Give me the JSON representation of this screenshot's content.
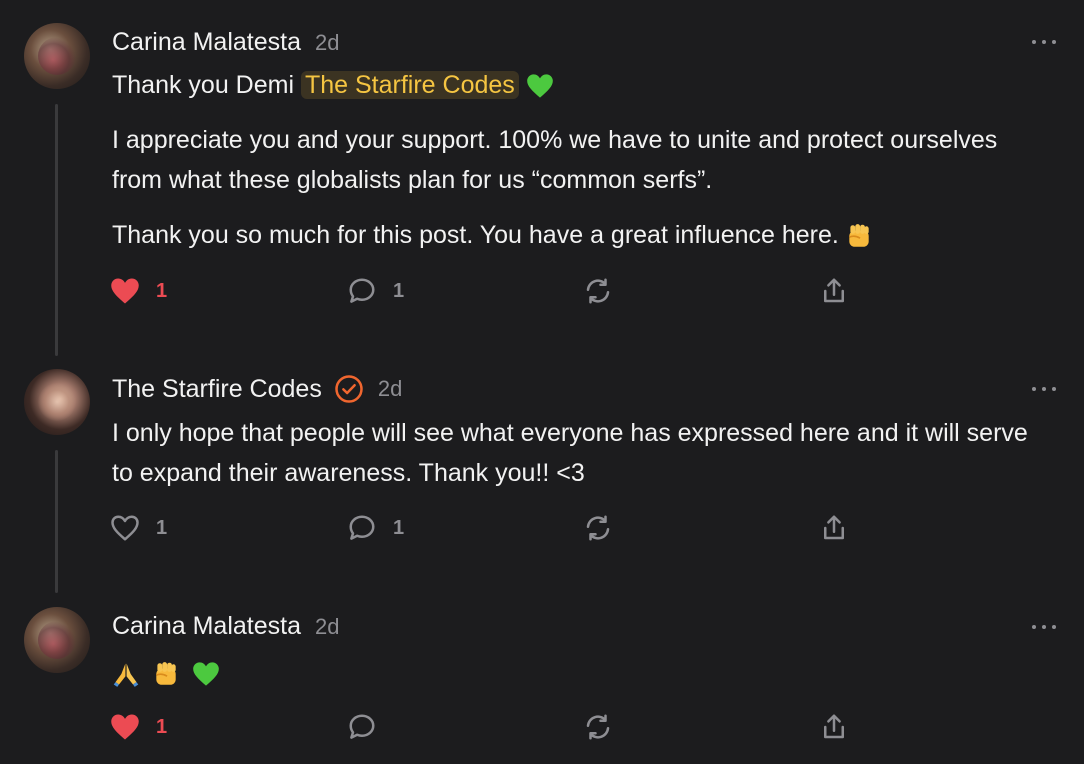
{
  "comments": [
    {
      "author": "Carina Malatesta",
      "time": "2d",
      "line1_prefix": "Thank you Demi",
      "mention": "The Starfire Codes",
      "para1": "I appreciate you and your support. 100% we have to unite and protect ourselves from what these globalists plan for us “common serfs”.",
      "para2": "Thank you so much for this post. You have a great influence here.",
      "likes": "1",
      "liked": true,
      "replies": "1"
    },
    {
      "author": "The Starfire Codes",
      "time": "2d",
      "verified": true,
      "para1": "I only hope that people will see what everyone has expressed here and it will serve to expand their awareness. Thank you!! <3",
      "likes": "1",
      "liked": false,
      "replies": "1"
    },
    {
      "author": "Carina Malatesta",
      "time": "2d",
      "likes": "1",
      "liked": true,
      "replies": ""
    }
  ],
  "colors": {
    "background": "#1c1c1e",
    "like_active": "#ec4b53",
    "mention_text": "#f5c542",
    "verified_badge": "#f0662f",
    "muted": "#8e8e93"
  },
  "icons": [
    "heart-icon",
    "comment-icon",
    "restack-icon",
    "share-icon",
    "verified-icon",
    "more-icon",
    "green-heart-emoji",
    "raised-fist-emoji",
    "folded-hands-emoji"
  ]
}
